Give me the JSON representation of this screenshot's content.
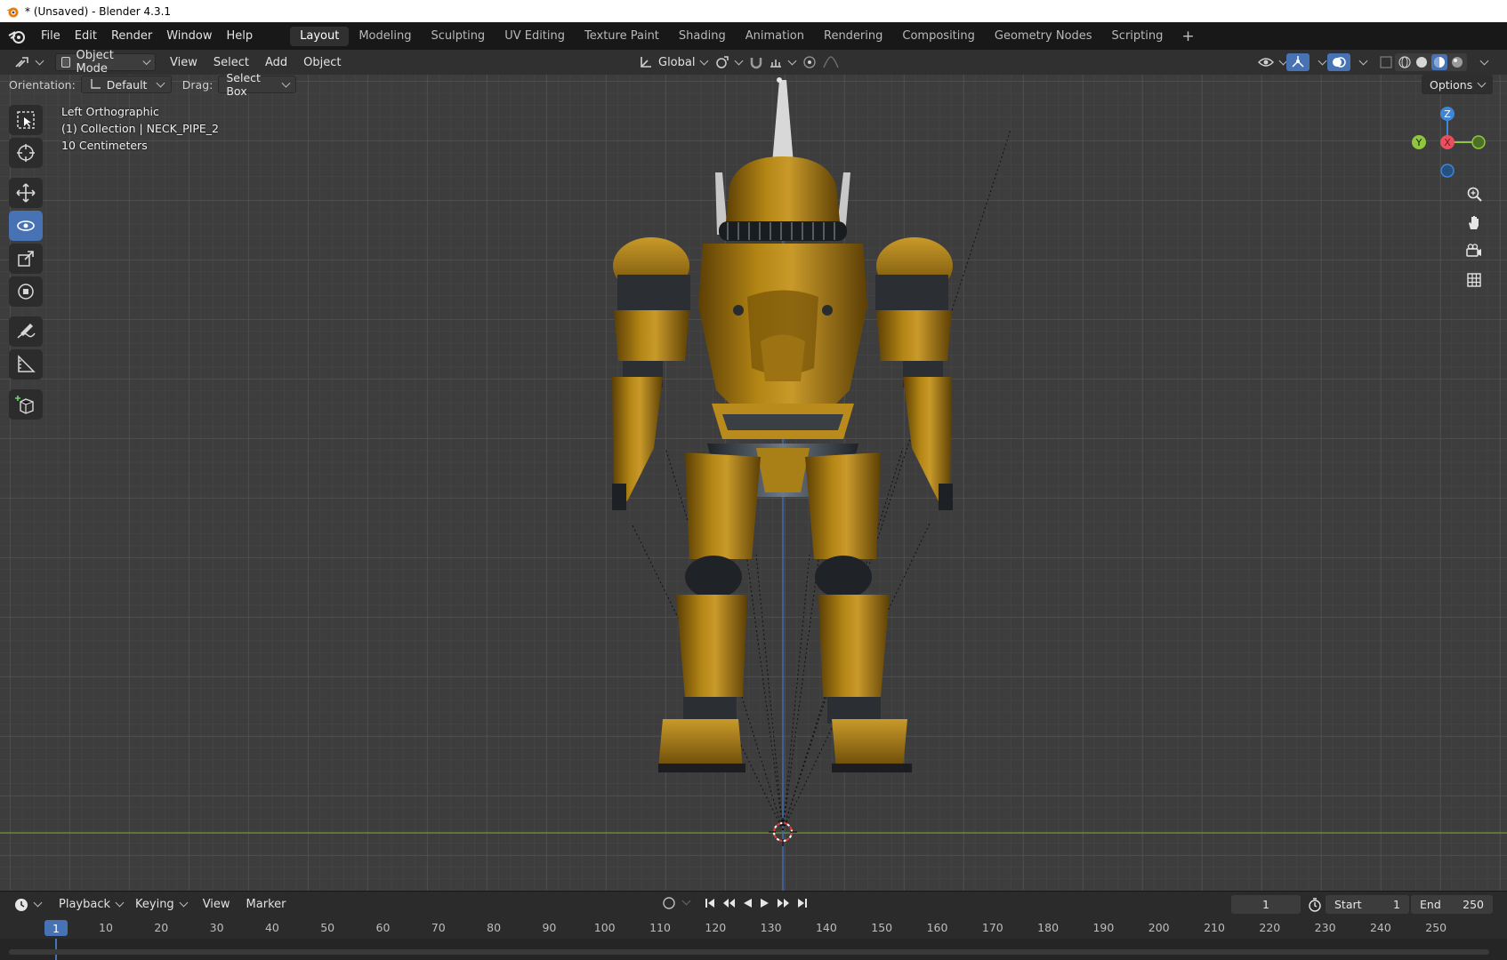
{
  "window": {
    "title": "* (Unsaved) - Blender 4.3.1"
  },
  "menu": {
    "items": [
      "File",
      "Edit",
      "Render",
      "Window",
      "Help"
    ]
  },
  "workspaces": {
    "tabs": [
      "Layout",
      "Modeling",
      "Sculpting",
      "UV Editing",
      "Texture Paint",
      "Shading",
      "Animation",
      "Rendering",
      "Compositing",
      "Geometry Nodes",
      "Scripting"
    ],
    "add": "+"
  },
  "header": {
    "mode": "Object Mode",
    "menus": [
      "View",
      "Select",
      "Add",
      "Object"
    ],
    "transform_orientation": "Global"
  },
  "toolsettings": {
    "orientation_label": "Orientation:",
    "orientation_value": "Default",
    "drag_label": "Drag:",
    "drag_value": "Select Box",
    "options": "Options"
  },
  "viewport": {
    "view_name": "Left Orthographic",
    "collection": "(1) Collection | NECK_PIPE_2",
    "scale": "10 Centimeters",
    "model": "armored-robot-figure",
    "colors": {
      "armor": "#9a6f0c",
      "armor_light": "#c99a2a",
      "armor_dark": "#5c3f05",
      "metal": "#3a3f44",
      "floor_line": "#6c9a3a",
      "z_axis_line": "#3f6fb5"
    }
  },
  "gizmo": {
    "z": "Z",
    "y": "Y",
    "x": "X",
    "colors": {
      "x": "#e8505e",
      "y": "#8ec73b",
      "z": "#3f86d6"
    }
  },
  "timeline": {
    "menus": [
      "Playback",
      "Keying",
      "View",
      "Marker"
    ],
    "current_frame": "1",
    "start_label": "Start",
    "start_value": "1",
    "end_label": "End",
    "end_value": "250",
    "ruler": [
      "10",
      "20",
      "30",
      "40",
      "50",
      "60",
      "70",
      "80",
      "90",
      "100",
      "110",
      "120",
      "130",
      "140",
      "150",
      "160",
      "170",
      "180",
      "190",
      "200",
      "210",
      "220",
      "230",
      "240",
      "250"
    ],
    "playhead": "1"
  }
}
